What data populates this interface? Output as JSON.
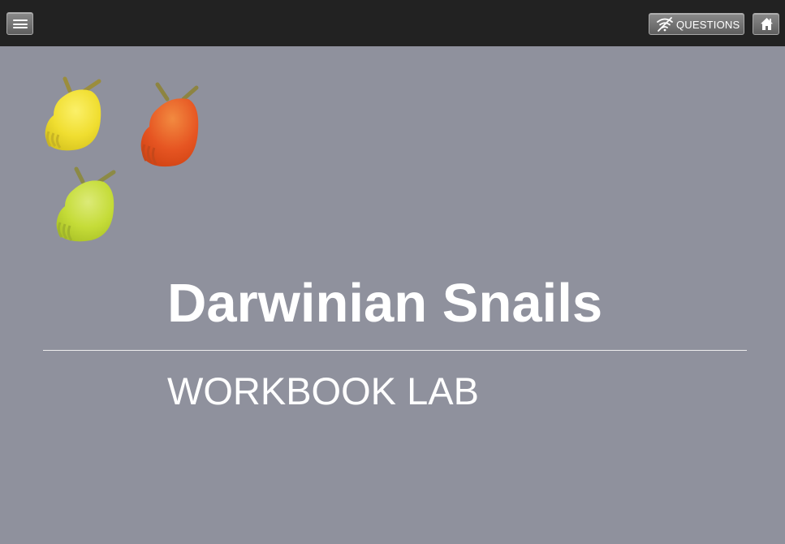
{
  "header": {
    "menu_icon": "menu-icon",
    "questions_label": "QUESTIONS",
    "questions_icon": "no-signal-icon",
    "home_icon": "home-icon"
  },
  "snails": [
    {
      "name": "yellow-snail",
      "color": "#f0e23a"
    },
    {
      "name": "orange-snail",
      "color": "#e9572a"
    },
    {
      "name": "green-snail",
      "color": "#c5dc3a"
    }
  ],
  "main": {
    "title": "Darwinian Snails",
    "subtitle": "WORKBOOK LAB"
  },
  "colors": {
    "background": "#8f919d",
    "topbar": "#222222",
    "text": "#ffffff"
  }
}
